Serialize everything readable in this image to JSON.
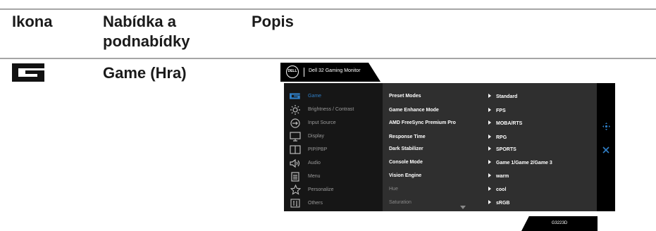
{
  "table": {
    "headers": [
      "Ikona",
      "Nabídka a\npodnabídky",
      "Popis"
    ],
    "row": {
      "menu_name": "Game (Hra)"
    }
  },
  "osd": {
    "brand": "DELL",
    "title": "Dell 32 Gaming Monitor",
    "menu_items": [
      {
        "icon": "game-icon",
        "label": "Game",
        "active": true
      },
      {
        "icon": "brightness-icon",
        "label": "Brightness / Contrast"
      },
      {
        "icon": "input-source-icon",
        "label": "Input Source"
      },
      {
        "icon": "display-icon",
        "label": "Display"
      },
      {
        "icon": "pip-pbp-icon",
        "label": "PIP/PBP"
      },
      {
        "icon": "audio-icon",
        "label": "Audio"
      },
      {
        "icon": "menu-icon",
        "label": "Menu"
      },
      {
        "icon": "personalize-star-icon",
        "label": "Personalize"
      },
      {
        "icon": "others-icon",
        "label": "Others"
      }
    ],
    "submenu": [
      "Preset Modes",
      "Game Enhance Mode",
      "AMD FreeSync Premium Pro",
      "Response Time",
      "Dark Stabilizer",
      "Console Mode",
      "Vision Engine",
      "Hue",
      "Saturation"
    ],
    "options": [
      "Standard",
      "FPS",
      "MOBA/RTS",
      "RPG",
      "SPORTS",
      "Game 1/Game 2/Game 3",
      "warm",
      "cool",
      "sRGB"
    ],
    "model": "G3223D",
    "colors": {
      "accent": "#2f7ec5"
    }
  }
}
